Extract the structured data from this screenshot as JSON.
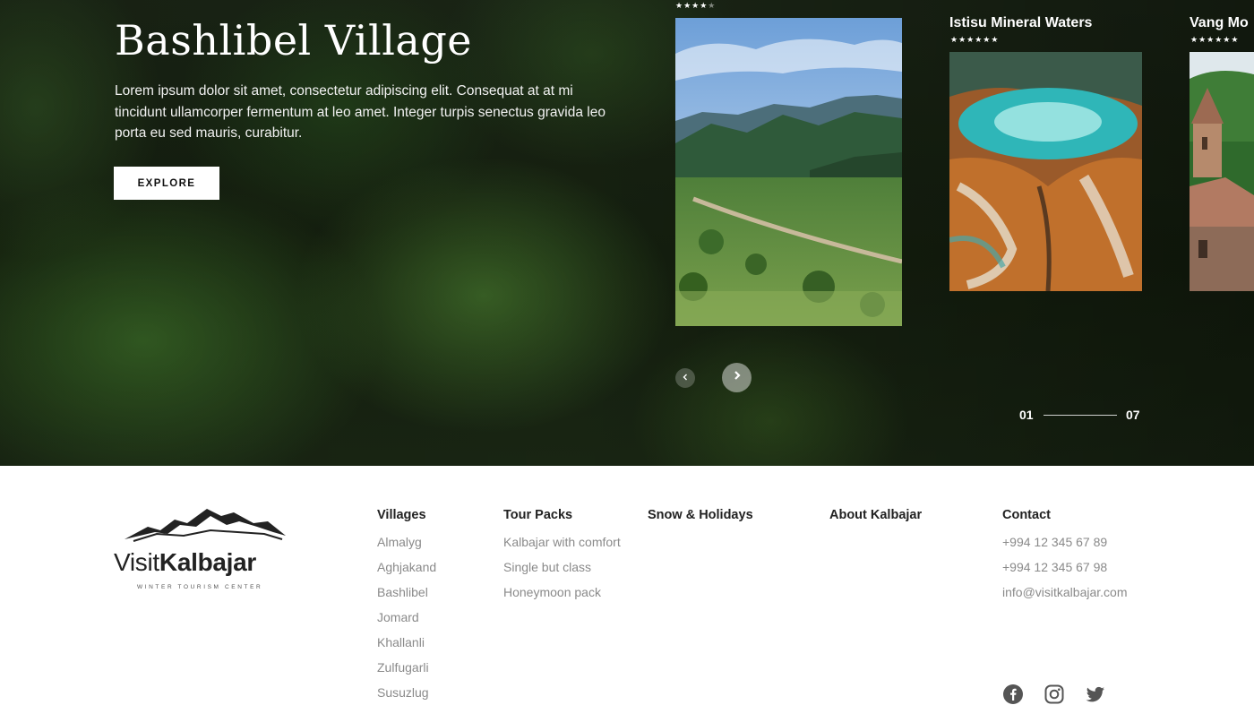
{
  "hero": {
    "title": "Bashlibel Village",
    "description": "Lorem ipsum dolor sit amet, consectetur adipiscing elit. Consequat at at mi tincidunt ullamcorper fermentum at leo amet. Integer turpis senectus gravida leo porta eu sed mauris, curabitur.",
    "explore_label": "EXPLORE"
  },
  "carousel": {
    "cards": [
      {
        "title": "",
        "stars_filled": "★★★★",
        "stars_empty": "★",
        "rating": 4
      },
      {
        "title": "Istisu Mineral Waters",
        "stars": "★★★★★★",
        "rating": 6
      },
      {
        "title": "Vang Mo",
        "stars": "★★★★★★",
        "rating": 6
      }
    ],
    "prev_icon": "chevron-left-icon",
    "next_icon": "chevron-right-icon",
    "pager_start": "01",
    "pager_end": "07"
  },
  "footer": {
    "logo": {
      "brand_light": "Visit",
      "brand_bold": "Kalbajar",
      "tagline": "WINTER TOURISM CENTER"
    },
    "columns": [
      {
        "heading": "Villages",
        "links": [
          "Almalyg",
          "Aghjakand",
          "Bashlibel",
          "Jomard",
          "Khallanli",
          "Zulfugarli",
          "Susuzlug"
        ]
      },
      {
        "heading": "Tour Packs",
        "links": [
          "Kalbajar with comfort",
          "Single but class",
          "Honeymoon pack"
        ]
      },
      {
        "heading": "Snow & Holidays",
        "links": []
      },
      {
        "heading": "About Kalbajar",
        "links": []
      },
      {
        "heading": "Contact",
        "links": [
          "+994 12 345 67 89",
          "+994 12 345 67 98",
          "info@visitkalbajar.com"
        ]
      }
    ],
    "social": [
      "facebook-icon",
      "instagram-icon",
      "twitter-icon"
    ],
    "colors": {
      "heading": "#222222",
      "link": "#8a8a8a",
      "icon": "#555555"
    }
  }
}
